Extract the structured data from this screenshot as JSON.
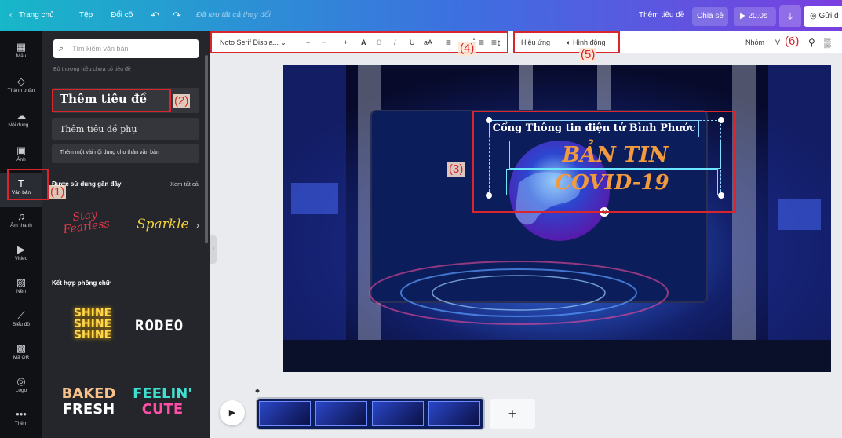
{
  "topbar": {
    "home": "Trang chủ",
    "file": "Tệp",
    "resize": "Đổi cỡ",
    "save_status": "Đã lưu tất cả thay đổi",
    "doc_title": "Thêm tiêu đề",
    "share": "Chia sẻ",
    "duration": "20.0s",
    "send": "Gửi đ"
  },
  "rail": [
    {
      "label": "Mẫu",
      "icon": "template-icon"
    },
    {
      "label": "Thành phần",
      "icon": "elements-icon"
    },
    {
      "label": "Nội dung ...",
      "icon": "upload-icon"
    },
    {
      "label": "Ảnh",
      "icon": "photo-icon"
    },
    {
      "label": "Văn bản",
      "icon": "text-icon"
    },
    {
      "label": "Âm thanh",
      "icon": "music-icon"
    },
    {
      "label": "Video",
      "icon": "video-icon"
    },
    {
      "label": "Nền",
      "icon": "background-icon"
    },
    {
      "label": "Biểu đồ",
      "icon": "chart-icon"
    },
    {
      "label": "Mã QR",
      "icon": "qr-icon"
    },
    {
      "label": "Logo",
      "icon": "logo-icon"
    },
    {
      "label": "Thêm",
      "icon": "more-icon"
    }
  ],
  "panel": {
    "search_placeholder": "Tìm kiếm văn bản",
    "brand_note": "Bộ thương hiệu chưa có tiêu đề",
    "add_heading": "Thêm tiêu đề",
    "add_subheading": "Thêm tiêu đề phụ",
    "add_body": "Thêm một vài nội dung cho thân văn bản",
    "recent_title": "Được sử dụng gần đây",
    "see_all": "Xem tất cả",
    "recent_1": "Stay Fearless",
    "recent_2": "Sparkle",
    "combo_title": "Kết hợp phông chữ",
    "combo_shine": "SHINE",
    "combo_rodeo": "RODEO",
    "combo_baked_1": "BAKED",
    "combo_baked_2": "FRESH",
    "combo_feelin_1": "FEELIN'",
    "combo_feelin_2": "CUTE"
  },
  "toolbar": {
    "font": "Noto Serif Displa...",
    "font_size": "--",
    "case": "aA",
    "effects": "Hiệu ứng",
    "animate": "Hình động",
    "group": "Nhóm",
    "extra": "V"
  },
  "canvas": {
    "line1": "Cổng Thông tin điện tử Bình Phước",
    "line2": "BẢN TIN",
    "line3": "COVID-19"
  },
  "callouts": {
    "c1": "(1)",
    "c2": "(2)",
    "c3": "(3)",
    "c4": "(4)",
    "c5": "(5)",
    "c6": "(6)"
  },
  "colors": {
    "callout": "#d9262c",
    "title_orange": "#f39a3c",
    "topbar_start": "#18b7c9",
    "topbar_end": "#7a3fe0"
  }
}
